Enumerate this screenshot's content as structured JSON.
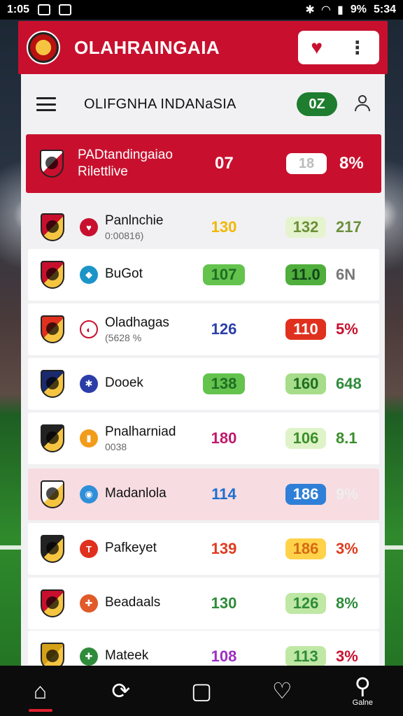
{
  "status_bar": {
    "time": "1:05",
    "battery": "9%",
    "clock_right": "5:34"
  },
  "app": {
    "title": "OLAHRAINGAIA"
  },
  "toolbar": {
    "title": "OLIFGNHA INDANaSIA",
    "count": "0Z"
  },
  "featured": {
    "name": "PADtandingaiao",
    "sub": "Rilettlive",
    "v1": "07",
    "v2": "18",
    "v3": "8%",
    "crest_color": "#ffffff"
  },
  "rows": [
    {
      "name": "Panlnchie",
      "sub": "0:00816)",
      "v1": "130",
      "v1_color": "#f2b705",
      "v1_bg": "",
      "v2": "132",
      "v2_color": "#6a8f3a",
      "v2_bg": "#e6f3cf",
      "v3": "217",
      "v3_color": "#6a8f3a",
      "crest": "#c8102e",
      "mini": "#c8102e",
      "mini_glyph": "♥"
    },
    {
      "name": "BuGot",
      "sub": "",
      "v1": "107",
      "v1_color": "#1f6d22",
      "v1_bg": "#63c34d",
      "v2": "11.0",
      "v2_color": "#12451a",
      "v2_bg": "#4fae3c",
      "v3": "6N",
      "v3_color": "#777777",
      "crest": "#c8102e",
      "mini": "#1c94c8",
      "mini_glyph": "◆"
    },
    {
      "name": "Oladhagas",
      "sub": "(5628 %",
      "v1": "126",
      "v1_color": "#2b3ea8",
      "v1_bg": "",
      "v2": "110",
      "v2_color": "#ffffff",
      "v2_bg": "#e0301e",
      "v3": "5%",
      "v3_color": "#c8102e",
      "crest": "#e0301e",
      "mini": "#ffffff",
      "mini_glyph": "◐"
    },
    {
      "name": "Dooek",
      "sub": "",
      "v1": "138",
      "v1_color": "#1f6d22",
      "v1_bg": "#63c34d",
      "v2": "160",
      "v2_color": "#1f6d22",
      "v2_bg": "#a6dc8a",
      "v3": "648",
      "v3_color": "#2e8b3a",
      "crest": "#1a2a6c",
      "mini": "#2b3ea8",
      "mini_glyph": "✱"
    },
    {
      "name": "Pnalharniad",
      "sub": "0038",
      "v1": "180",
      "v1_color": "#c2186b",
      "v1_bg": "",
      "v2": "106",
      "v2_color": "#3a8f2a",
      "v2_bg": "#dff3c9",
      "v3": "8.1",
      "v3_color": "#3a8f2a",
      "crest": "#222222",
      "mini": "#f29c1b",
      "mini_glyph": "▮"
    },
    {
      "name": "Madanlola",
      "sub": "",
      "v1": "114",
      "v1_color": "#1c6fd0",
      "v1_bg": "",
      "v2": "186",
      "v2_color": "#ffffff",
      "v2_bg": "#2f7fd8",
      "v3": "9%",
      "v3_color": "#eeeeee",
      "crest": "#ffffff",
      "mini": "#2f8fd8",
      "mini_glyph": "◉"
    },
    {
      "name": "Pafkeyet",
      "sub": "",
      "v1": "139",
      "v1_color": "#e03a1e",
      "v1_bg": "",
      "v2": "186",
      "v2_color": "#d46a12",
      "v2_bg": "#ffd24a",
      "v3": "3%",
      "v3_color": "#e03a1e",
      "crest": "#222222",
      "mini": "#e0301e",
      "mini_glyph": "T"
    },
    {
      "name": "Beadaals",
      "sub": "",
      "v1": "130",
      "v1_color": "#2e8b3a",
      "v1_bg": "",
      "v2": "126",
      "v2_color": "#2e8b3a",
      "v2_bg": "#bfe8a4",
      "v3": "8%",
      "v3_color": "#2e8b3a",
      "crest": "#c8102e",
      "mini": "#e05a2a",
      "mini_glyph": "✚"
    },
    {
      "name": "Mateek",
      "sub": "",
      "v1": "108",
      "v1_color": "#9b2fc4",
      "v1_bg": "",
      "v2": "113",
      "v2_color": "#2e8b3a",
      "v2_bg": "#bfe8a4",
      "v3": "3%",
      "v3_color": "#c8102e",
      "crest": "#d4a017",
      "mini": "#2e8b3a",
      "mini_glyph": "✚"
    }
  ],
  "bottom_nav": [
    {
      "icon": "home-icon",
      "glyph": "⌂",
      "label": ""
    },
    {
      "icon": "refresh-icon",
      "glyph": "⟳",
      "label": ""
    },
    {
      "icon": "square-icon",
      "glyph": "▢",
      "label": ""
    },
    {
      "icon": "heart-icon",
      "glyph": "♡",
      "label": ""
    },
    {
      "icon": "profile-icon",
      "glyph": "⚲",
      "label": "Galne"
    }
  ],
  "colors": {
    "brand": "#c8102e",
    "nav_bg": "#0c0c0c"
  }
}
